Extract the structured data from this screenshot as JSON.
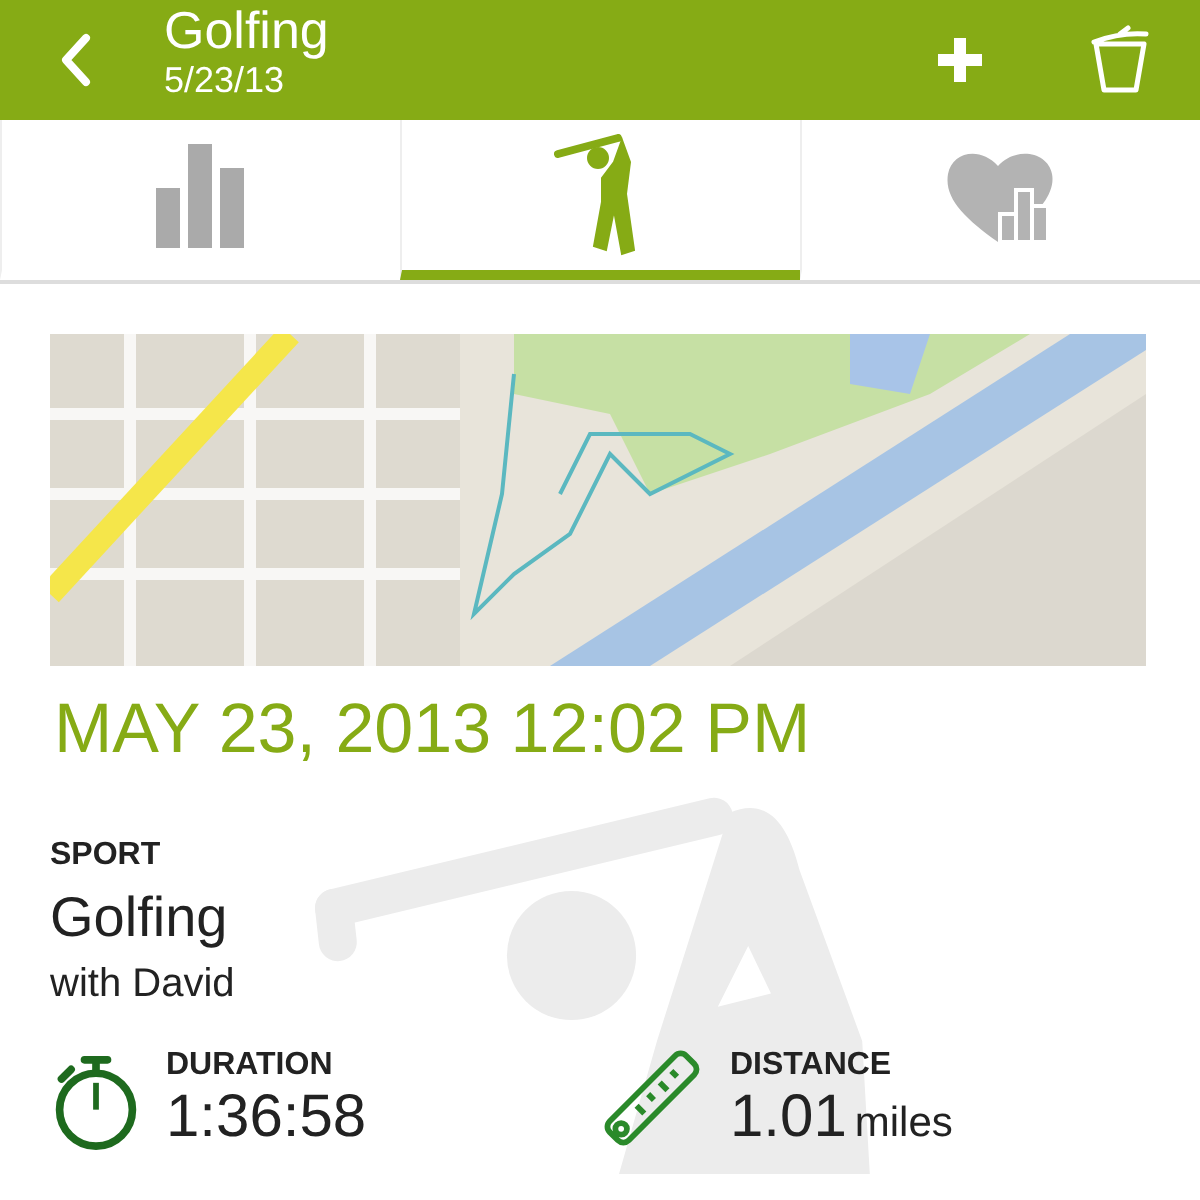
{
  "header": {
    "title": "Golfing",
    "subtitle": "5/23/13"
  },
  "tabs": [
    {
      "kind": "stats",
      "selected": false
    },
    {
      "kind": "activity",
      "selected": true
    },
    {
      "kind": "health",
      "selected": false
    }
  ],
  "date": "MAY 23, 2013 12:02 PM",
  "sport": {
    "label": "SPORT",
    "value": "Golfing",
    "companion": "with David"
  },
  "metrics": [
    {
      "kind": "duration",
      "label": "DURATION",
      "value": "1:36:58"
    },
    {
      "kind": "distance",
      "label": "DISTANCE",
      "value": "1.01",
      "unit": "miles"
    }
  ]
}
